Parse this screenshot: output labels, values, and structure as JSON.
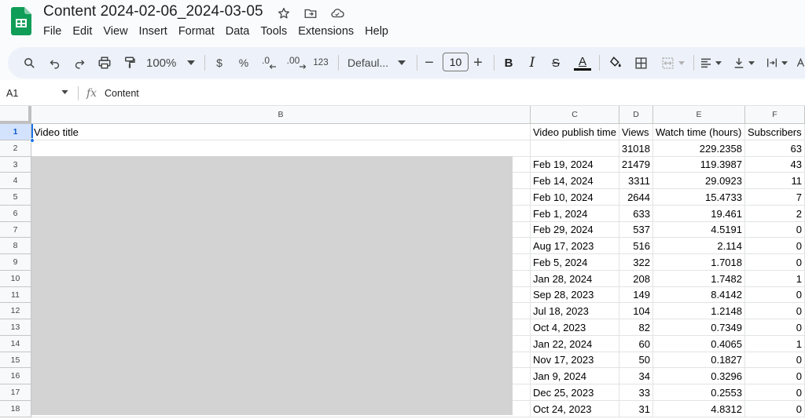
{
  "document": {
    "title": "Content 2024-02-06_2024-03-05"
  },
  "title_icons": [
    "star-icon",
    "move-to-folder-icon",
    "cloud-saved-icon"
  ],
  "menu": [
    "File",
    "Edit",
    "View",
    "Insert",
    "Format",
    "Data",
    "Tools",
    "Extensions",
    "Help"
  ],
  "toolbar": {
    "zoom": "100%",
    "currency": "$",
    "percent": "%",
    "decrease_decimal": ".0",
    "increase_decimal": ".00",
    "number_format": "123",
    "font": "Defaul...",
    "font_size": "10",
    "minus": "−",
    "plus": "+",
    "bold": "B",
    "italic": "I",
    "strike": "S",
    "text_color": "A",
    "text_color_bar": "#000000"
  },
  "formula_bar": {
    "cell_ref": "A1",
    "fx": "fx",
    "content": "Content"
  },
  "columns": [
    "B",
    "C",
    "D",
    "E",
    "F"
  ],
  "rows": [
    [
      "Video title",
      "Video publish time",
      "Views",
      "Watch time (hours)",
      "Subscribers"
    ],
    [
      "",
      "",
      "31018",
      "229.2358",
      "63"
    ],
    [
      "",
      "Feb 19, 2024",
      "21479",
      "119.3987",
      "43"
    ],
    [
      "",
      "Feb 14, 2024",
      "3311",
      "29.0923",
      "11"
    ],
    [
      "",
      "Feb 10, 2024",
      "2644",
      "15.4733",
      "7"
    ],
    [
      "",
      "Feb 1, 2024",
      "633",
      "19.461",
      "2"
    ],
    [
      "",
      "Feb 29, 2024",
      "537",
      "4.5191",
      "0"
    ],
    [
      "",
      "Aug 17, 2023",
      "516",
      "2.114",
      "0"
    ],
    [
      "",
      "Feb 5, 2024",
      "322",
      "1.7018",
      "0"
    ],
    [
      "",
      "Jan 28, 2024",
      "208",
      "1.7482",
      "1"
    ],
    [
      "",
      "Sep 28, 2023",
      "149",
      "8.4142",
      "0"
    ],
    [
      "",
      "Jul 18, 2023",
      "104",
      "1.2148",
      "0"
    ],
    [
      "",
      "Oct 4, 2023",
      "82",
      "0.7349",
      "0"
    ],
    [
      "",
      "Jan 22, 2024",
      "60",
      "0.4065",
      "1"
    ],
    [
      "",
      "Nov 17, 2023",
      "50",
      "0.1827",
      "0"
    ],
    [
      "",
      "Jan 9, 2024",
      "34",
      "0.3296",
      "0"
    ],
    [
      "",
      "Dec 25, 2023",
      "33",
      "0.2553",
      "0"
    ],
    [
      "",
      "Oct 24, 2023",
      "31",
      "4.8312",
      "0"
    ]
  ],
  "row_numbers": [
    "1",
    "2",
    "3",
    "4",
    "5",
    "6",
    "7",
    "8",
    "9",
    "10",
    "11",
    "12",
    "13",
    "14",
    "15",
    "16",
    "17",
    "18"
  ],
  "colors": {
    "accent": "#1a73e8",
    "sheets_green": "#0f9d58",
    "toolbar_bg": "#edf2fa",
    "redaction": "#d3d3d3"
  }
}
